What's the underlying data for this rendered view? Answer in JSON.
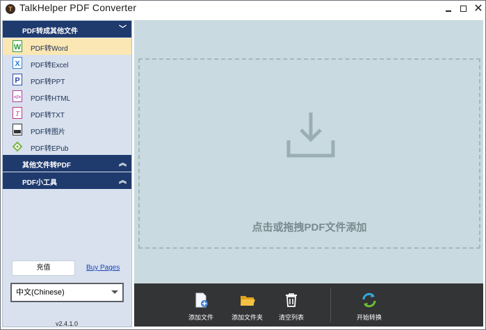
{
  "window": {
    "title": "TalkHelper PDF Converter",
    "close_glyph": "✕"
  },
  "sidebar": {
    "group1": {
      "title": "PDF转成其他文件",
      "chevron": "﹀"
    },
    "items": [
      {
        "label": "PDF转Word",
        "icon": "word-icon",
        "color": "#2e9b3a"
      },
      {
        "label": "PDF转Excel",
        "icon": "excel-icon",
        "color": "#2c7ed6"
      },
      {
        "label": "PDF转PPT",
        "icon": "ppt-icon",
        "color": "#2b4aa8"
      },
      {
        "label": "PDF转HTML",
        "icon": "html-icon",
        "color": "#b43aa0"
      },
      {
        "label": "PDF转TXT",
        "icon": "txt-icon",
        "color": "#c2358a"
      },
      {
        "label": "PDF转图片",
        "icon": "image-icon",
        "color": "#333333"
      },
      {
        "label": "PDF转EPub",
        "icon": "epub-icon",
        "color": "#7bb140"
      }
    ],
    "group2": {
      "title": "其他文件转PDF",
      "chevron": "︽"
    },
    "group3": {
      "title": "PDF小工具",
      "chevron": "︽"
    },
    "recharge_label": "充值",
    "buy_label": "Buy Pages",
    "language": "中文(Chinese)",
    "version": "v2.4.1.0"
  },
  "main": {
    "drop_text": "点击或拖拽PDF文件添加"
  },
  "bottom": {
    "add_file": "添加文件",
    "add_folder": "添加文件夹",
    "clear_list": "清空列表",
    "start": "开始转换"
  },
  "colors": {
    "accent_dark": "#1f3a6d",
    "active_item": "#fbe7b3",
    "drop_area": "#c9dbe0",
    "bottom_bar": "#333435"
  }
}
